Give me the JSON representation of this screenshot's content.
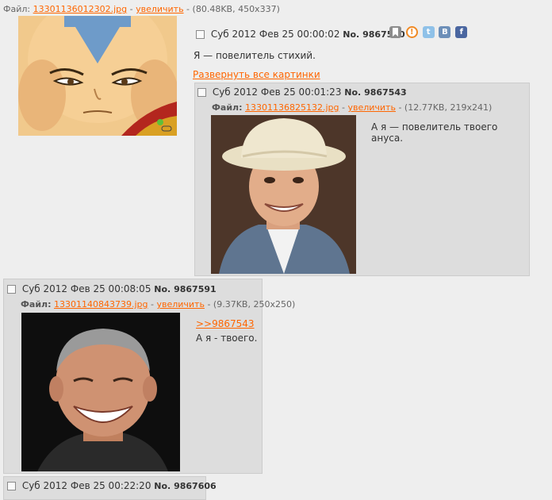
{
  "op": {
    "file_prefix": "Файл:",
    "file_name": "13301136012302.jpg",
    "enlarge": "увеличить",
    "file_meta": "(80.48KB, 450x337)",
    "date": "Суб 2012 Фев 25 00:00:02",
    "no_label": "No.",
    "number": "9867530",
    "message": "Я — повелитель стихий.",
    "expand_all": "Развернуть все картинки"
  },
  "replies": [
    {
      "date": "Суб 2012 Фев 25 00:01:23",
      "no_label": "No.",
      "number": "9867543",
      "file_prefix": "Файл:",
      "file_name": "13301136825132.jpg",
      "enlarge": "увеличить",
      "file_meta": "(12.77KB, 219x241)",
      "message": "А я — повелитель твоего ануса."
    },
    {
      "date": "Суб 2012 Фев 25 00:08:05",
      "no_label": "No.",
      "number": "9867591",
      "file_prefix": "Файл:",
      "file_name": "13301140843739.jpg",
      "enlarge": "увеличить",
      "file_meta": "(9.37KB, 250x250)",
      "quote_link": ">>9867543",
      "message": "А я - твоего."
    },
    {
      "date": "Суб 2012 Фев 25 00:22:20",
      "no_label": "No.",
      "number": "9867606"
    }
  ],
  "share_icons": [
    "bookmark-icon",
    "odnoklassniki-icon",
    "twitter-icon",
    "vkontakte-icon",
    "facebook-icon"
  ],
  "share_glyphs": {
    "vk": "В",
    "fb": "f",
    "tw": "t"
  },
  "colors": {
    "link": "#ff6600",
    "reply_bg": "#dddddd",
    "page_bg": "#eeeeee"
  }
}
